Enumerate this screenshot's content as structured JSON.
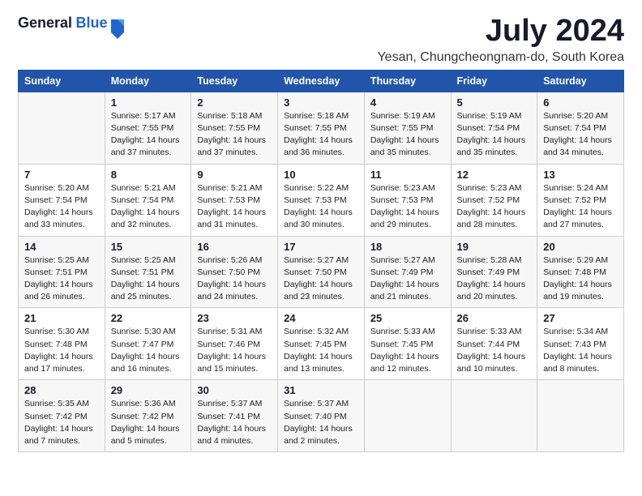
{
  "logo": {
    "general": "General",
    "blue": "Blue"
  },
  "title": "July 2024",
  "location": "Yesan, Chungcheongnam-do, South Korea",
  "days_of_week": [
    "Sunday",
    "Monday",
    "Tuesday",
    "Wednesday",
    "Thursday",
    "Friday",
    "Saturday"
  ],
  "weeks": [
    [
      {
        "day": "",
        "info": ""
      },
      {
        "day": "1",
        "info": "Sunrise: 5:17 AM\nSunset: 7:55 PM\nDaylight: 14 hours\nand 37 minutes."
      },
      {
        "day": "2",
        "info": "Sunrise: 5:18 AM\nSunset: 7:55 PM\nDaylight: 14 hours\nand 37 minutes."
      },
      {
        "day": "3",
        "info": "Sunrise: 5:18 AM\nSunset: 7:55 PM\nDaylight: 14 hours\nand 36 minutes."
      },
      {
        "day": "4",
        "info": "Sunrise: 5:19 AM\nSunset: 7:55 PM\nDaylight: 14 hours\nand 35 minutes."
      },
      {
        "day": "5",
        "info": "Sunrise: 5:19 AM\nSunset: 7:54 PM\nDaylight: 14 hours\nand 35 minutes."
      },
      {
        "day": "6",
        "info": "Sunrise: 5:20 AM\nSunset: 7:54 PM\nDaylight: 14 hours\nand 34 minutes."
      }
    ],
    [
      {
        "day": "7",
        "info": "Sunrise: 5:20 AM\nSunset: 7:54 PM\nDaylight: 14 hours\nand 33 minutes."
      },
      {
        "day": "8",
        "info": "Sunrise: 5:21 AM\nSunset: 7:54 PM\nDaylight: 14 hours\nand 32 minutes."
      },
      {
        "day": "9",
        "info": "Sunrise: 5:21 AM\nSunset: 7:53 PM\nDaylight: 14 hours\nand 31 minutes."
      },
      {
        "day": "10",
        "info": "Sunrise: 5:22 AM\nSunset: 7:53 PM\nDaylight: 14 hours\nand 30 minutes."
      },
      {
        "day": "11",
        "info": "Sunrise: 5:23 AM\nSunset: 7:53 PM\nDaylight: 14 hours\nand 29 minutes."
      },
      {
        "day": "12",
        "info": "Sunrise: 5:23 AM\nSunset: 7:52 PM\nDaylight: 14 hours\nand 28 minutes."
      },
      {
        "day": "13",
        "info": "Sunrise: 5:24 AM\nSunset: 7:52 PM\nDaylight: 14 hours\nand 27 minutes."
      }
    ],
    [
      {
        "day": "14",
        "info": "Sunrise: 5:25 AM\nSunset: 7:51 PM\nDaylight: 14 hours\nand 26 minutes."
      },
      {
        "day": "15",
        "info": "Sunrise: 5:25 AM\nSunset: 7:51 PM\nDaylight: 14 hours\nand 25 minutes."
      },
      {
        "day": "16",
        "info": "Sunrise: 5:26 AM\nSunset: 7:50 PM\nDaylight: 14 hours\nand 24 minutes."
      },
      {
        "day": "17",
        "info": "Sunrise: 5:27 AM\nSunset: 7:50 PM\nDaylight: 14 hours\nand 23 minutes."
      },
      {
        "day": "18",
        "info": "Sunrise: 5:27 AM\nSunset: 7:49 PM\nDaylight: 14 hours\nand 21 minutes."
      },
      {
        "day": "19",
        "info": "Sunrise: 5:28 AM\nSunset: 7:49 PM\nDaylight: 14 hours\nand 20 minutes."
      },
      {
        "day": "20",
        "info": "Sunrise: 5:29 AM\nSunset: 7:48 PM\nDaylight: 14 hours\nand 19 minutes."
      }
    ],
    [
      {
        "day": "21",
        "info": "Sunrise: 5:30 AM\nSunset: 7:48 PM\nDaylight: 14 hours\nand 17 minutes."
      },
      {
        "day": "22",
        "info": "Sunrise: 5:30 AM\nSunset: 7:47 PM\nDaylight: 14 hours\nand 16 minutes."
      },
      {
        "day": "23",
        "info": "Sunrise: 5:31 AM\nSunset: 7:46 PM\nDaylight: 14 hours\nand 15 minutes."
      },
      {
        "day": "24",
        "info": "Sunrise: 5:32 AM\nSunset: 7:45 PM\nDaylight: 14 hours\nand 13 minutes."
      },
      {
        "day": "25",
        "info": "Sunrise: 5:33 AM\nSunset: 7:45 PM\nDaylight: 14 hours\nand 12 minutes."
      },
      {
        "day": "26",
        "info": "Sunrise: 5:33 AM\nSunset: 7:44 PM\nDaylight: 14 hours\nand 10 minutes."
      },
      {
        "day": "27",
        "info": "Sunrise: 5:34 AM\nSunset: 7:43 PM\nDaylight: 14 hours\nand 8 minutes."
      }
    ],
    [
      {
        "day": "28",
        "info": "Sunrise: 5:35 AM\nSunset: 7:42 PM\nDaylight: 14 hours\nand 7 minutes."
      },
      {
        "day": "29",
        "info": "Sunrise: 5:36 AM\nSunset: 7:42 PM\nDaylight: 14 hours\nand 5 minutes."
      },
      {
        "day": "30",
        "info": "Sunrise: 5:37 AM\nSunset: 7:41 PM\nDaylight: 14 hours\nand 4 minutes."
      },
      {
        "day": "31",
        "info": "Sunrise: 5:37 AM\nSunset: 7:40 PM\nDaylight: 14 hours\nand 2 minutes."
      },
      {
        "day": "",
        "info": ""
      },
      {
        "day": "",
        "info": ""
      },
      {
        "day": "",
        "info": ""
      }
    ]
  ]
}
